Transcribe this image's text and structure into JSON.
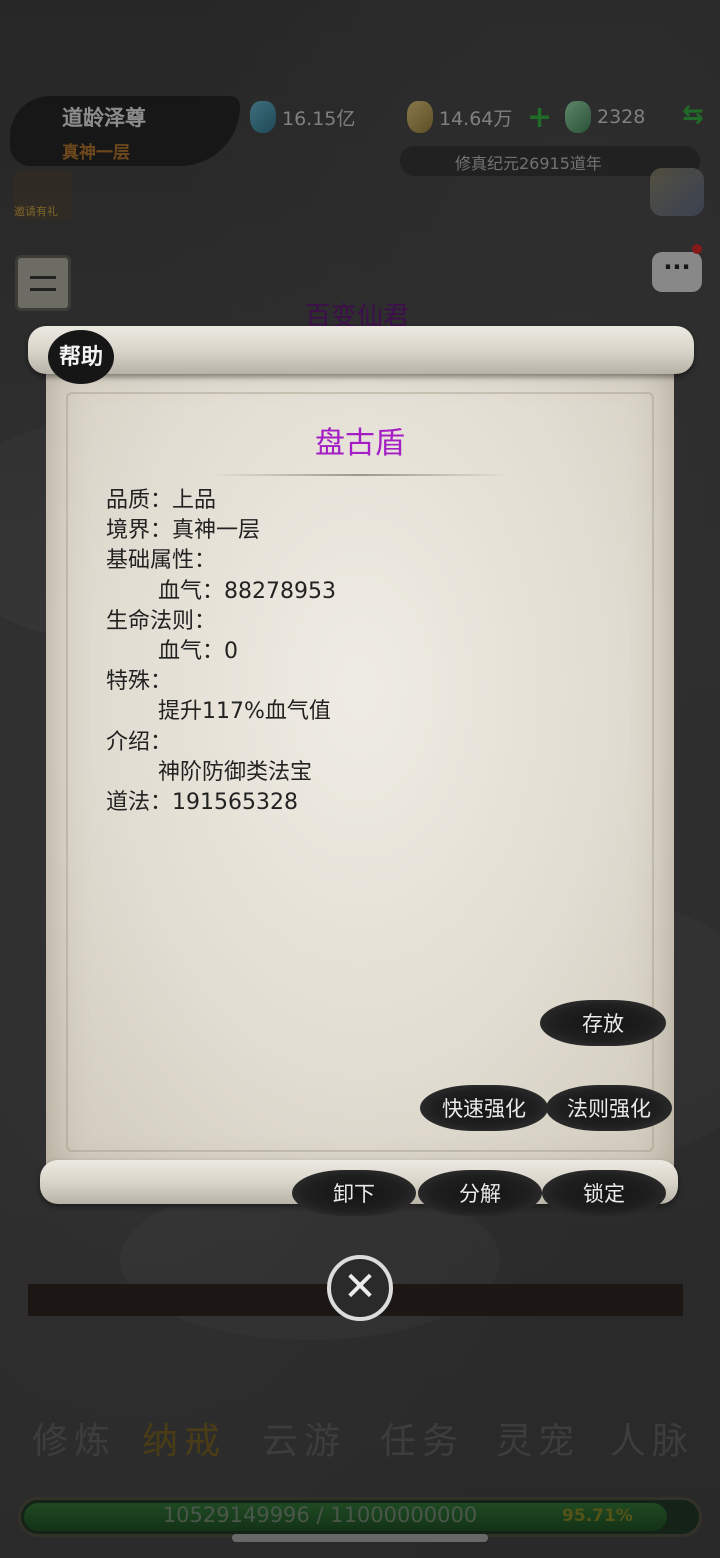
{
  "player": {
    "name": "道龄泽尊",
    "realm": "真神一层"
  },
  "resources": {
    "spirit_stone": "16.15亿",
    "gold": "14.64万",
    "jade": "2328",
    "plus_symbol": "+",
    "swap_symbol": "⇆"
  },
  "era": "修真纪元26915道年",
  "invite_label": "邀请有礼",
  "background_title": "百变仙君",
  "dialog": {
    "help_label": "帮助",
    "item_name": "盘古盾",
    "rows": [
      {
        "text": "品质：上品",
        "indent": false
      },
      {
        "text": "境界：真神一层",
        "indent": false
      },
      {
        "text": "基础属性：",
        "indent": false
      },
      {
        "text": "血气：88278953",
        "indent": true
      },
      {
        "text": "生命法则：",
        "indent": false
      },
      {
        "text": "血气：0",
        "indent": true
      },
      {
        "text": "特殊：",
        "indent": false
      },
      {
        "text": "提升117%血气值",
        "indent": true
      },
      {
        "text": "介绍：",
        "indent": false
      },
      {
        "text": "神阶防御类法宝",
        "indent": true
      },
      {
        "text": "道法：191565328",
        "indent": false
      }
    ],
    "buttons": {
      "store": "存放",
      "quick_enhance": "快速强化",
      "law_enhance": "法则强化",
      "unequip": "卸下",
      "decompose": "分解",
      "lock": "锁定"
    },
    "close_symbol": "✕"
  },
  "bottom_nav": {
    "items": [
      "修炼",
      "纳戒",
      "云游",
      "任务",
      "灵宠",
      "人脉"
    ],
    "active_index": 1
  },
  "exp": {
    "text": "10529149996 / 11000000000",
    "percent_label": "95.71%",
    "fraction": 0.9571
  },
  "colors": {
    "item_name": "#a51dc4",
    "realm": "#a06a2a",
    "accent_green": "#2f9e3a"
  }
}
